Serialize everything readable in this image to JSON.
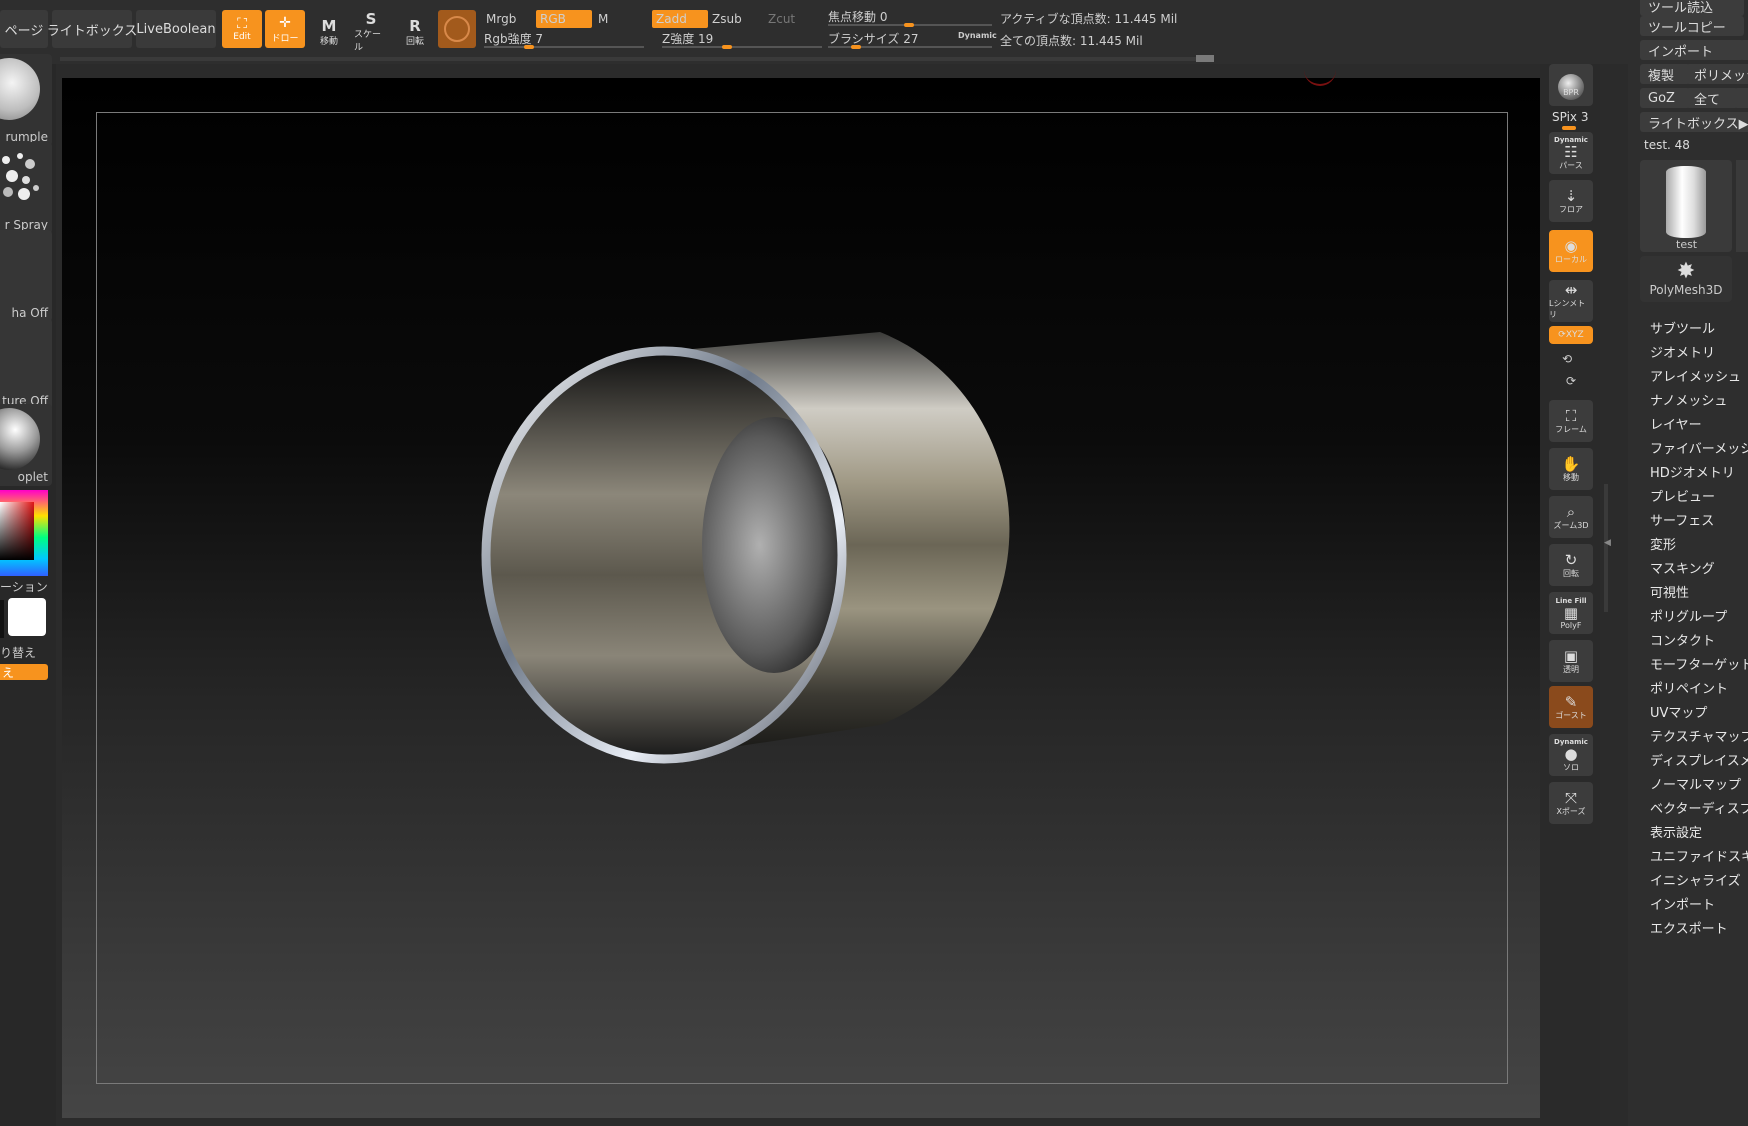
{
  "top_bar": {
    "page_tab": "ページ",
    "lightbox": "ライトボックス",
    "liveboolean": "LiveBoolean",
    "edit": "Edit",
    "draw": "ドロー",
    "move": "移動",
    "scale": "スケール",
    "rotate": "回転",
    "mrgb": "Mrgb",
    "rgb": "RGB",
    "m": "M",
    "rgb_intensity": "Rgb強度 7",
    "zadd": "Zadd",
    "zsub": "Zsub",
    "zcut": "Zcut",
    "z_intensity": "Z強度 19",
    "focal_shift": "焦点移動 0",
    "brush_size": "ブラシサイズ 27",
    "dynamic": "Dynamic",
    "active_points": "アクティブな頂点数: 11.445 Mil",
    "total_points": "全ての頂点数: 11.445 Mil"
  },
  "left_shelf": {
    "brush_label": "rumple",
    "stroke_label": "r Spray",
    "alpha_label": "ha Off",
    "texture_label": "ture Off",
    "material_label": "oplet",
    "gradient_label": "ーション",
    "switch_label": "り替え",
    "orange_label": "え"
  },
  "right_icons": [
    {
      "name": "bpr",
      "label": "BPR"
    },
    {
      "name": "spix",
      "label": "SPix 3"
    },
    {
      "name": "perspective",
      "label": "パース",
      "top": "Dynamic"
    },
    {
      "name": "floor",
      "label": "フロア"
    },
    {
      "name": "local",
      "label": "ローカル"
    },
    {
      "name": "symmetry",
      "label": "Lシンメトリ"
    },
    {
      "name": "xyz",
      "label": "XYZ"
    },
    {
      "name": "frame",
      "label": "フレーム"
    },
    {
      "name": "move",
      "label": "移動"
    },
    {
      "name": "zoom3d",
      "label": "ズーム3D"
    },
    {
      "name": "rotate",
      "label": "回転"
    },
    {
      "name": "polyf",
      "label": "PolyF",
      "top": "Line Fill"
    },
    {
      "name": "transp",
      "label": "透明"
    },
    {
      "name": "ghost",
      "label": "ゴースト"
    },
    {
      "name": "solo",
      "label": "ソロ",
      "top": "Dynamic"
    },
    {
      "name": "xpose",
      "label": "Xポーズ"
    }
  ],
  "tool_panel": {
    "load_tool": "ツール読込",
    "copy_tool": "ツールコピー",
    "import": "インポート",
    "duplicate": "複製",
    "polymesh": "ポリメッシ",
    "goz": "GoZ",
    "all": "全て",
    "lightbox_tool": "ライトボックス▶ツ",
    "current_tool": "test. 48",
    "thumb_label": "test",
    "polymesh3d": "PolyMesh3D",
    "menu": [
      "サブツール",
      "ジオメトリ",
      "アレイメッシュ",
      "ナノメッシュ",
      "レイヤー",
      "ファイバーメッシ",
      "HDジオメトリ",
      "プレビュー",
      "サーフェス",
      "変形",
      "マスキング",
      "可視性",
      "ポリグループ",
      "コンタクト",
      "モーフターゲット",
      "ポリペイント",
      "UVマップ",
      "テクスチャマップ",
      "ディスプレイスメ",
      "ノーマルマップ",
      "ベクターディスプ",
      "表示設定",
      "ユニファイドスキ",
      "イニシャライズ",
      "インポート",
      "エクスポート"
    ]
  },
  "colors": {
    "accent": "#f7931e",
    "panel": "#2e2e2e",
    "button": "#3a3a3a"
  }
}
